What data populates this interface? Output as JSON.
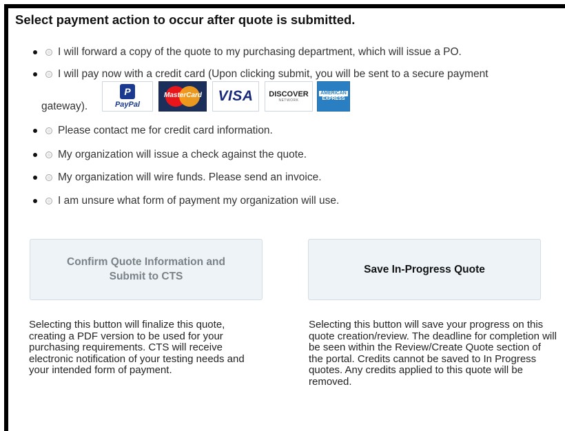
{
  "title": "Select payment action to occur after quote is submitted.",
  "options": [
    {
      "label": "I will forward a copy of the quote to my purchasing department, which will issue a PO."
    },
    {
      "label": "I will pay now with a credit card (Upon clicking submit, you will be sent to a secure payment",
      "continuation": "gateway)."
    },
    {
      "label": "Please contact me for credit card information."
    },
    {
      "label": "My organization will issue a check against the quote."
    },
    {
      "label": "My organization will wire funds. Please send an invoice."
    },
    {
      "label": "I am unsure what form of payment my organization will use."
    }
  ],
  "card_logos": {
    "paypal": "PayPal",
    "mastercard": "MasterCard",
    "visa": "VISA",
    "discover": "DISCOVER",
    "discover_sub": "NETWORK",
    "amex_top": "AMERICAN",
    "amex_bottom": "EXPRESS"
  },
  "buttons": {
    "confirm": "Confirm Quote Information and Submit to CTS",
    "save": "Save In-Progress Quote"
  },
  "descriptions": {
    "confirm": "Selecting this button will finalize this quote, creating a PDF version to be used for your purchasing requirements. CTS will receive electronic notification of your testing needs and your intended form of payment.",
    "save": "Selecting this button will save your progress on this quote creation/review. The deadline for completion will be seen within the Review/Create Quote section of the portal. Credits cannot be saved to In Progress quotes. Any credits applied to this quote will be removed."
  },
  "colors": {
    "button_bg": "#edf3f7",
    "button_border": "#d2dde6",
    "confirm_text": "#7a8288"
  }
}
